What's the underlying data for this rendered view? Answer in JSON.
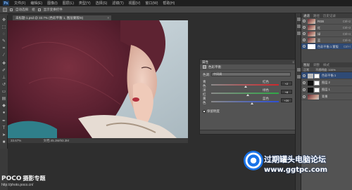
{
  "app": {
    "logo": "Ps"
  },
  "menu": [
    "文件(F)",
    "编辑(E)",
    "图像(I)",
    "图层(L)",
    "类型(Y)",
    "选择(S)",
    "滤镜(T)",
    "视图(V)",
    "窗口(W)",
    "帮助(H)"
  ],
  "options": {
    "label": "自动选择:",
    "mode": "组",
    "transform": "显示变换控件"
  },
  "document": {
    "tab": "未标题-1.psd @ 33.7% (色彩平衡 1, 图层蒙版/8)",
    "close": "×",
    "zoom": "33.67%",
    "info": "文档:45.3M/93.3M"
  },
  "color_balance": {
    "panel_title": "属性",
    "subtitle": "色彩平衡",
    "tone_label": "色调:",
    "tone_value": "中间调",
    "sliders": [
      {
        "left": "青色",
        "right": "红色",
        "value": "+2",
        "level": 0.51,
        "color": "#d0262b"
      },
      {
        "left": "洋红",
        "right": "绿色",
        "value": "+8",
        "level": 0.54,
        "color": "#2ea845"
      },
      {
        "left": "黄色",
        "right": "蓝色",
        "value": "+20",
        "level": 0.6,
        "color": "#2d4fd6"
      }
    ],
    "preserve": "保留明度"
  },
  "channels": {
    "tabs": [
      "通道",
      "路径",
      "历史记录"
    ],
    "items": [
      {
        "name": "RGB",
        "shortcut": "Ctrl+2"
      },
      {
        "name": "红",
        "shortcut": "Ctrl+3"
      },
      {
        "name": "绿",
        "shortcut": "Ctrl+4"
      },
      {
        "name": "蓝",
        "shortcut": "Ctrl+5"
      },
      {
        "name": "色彩平衡 1 蒙版",
        "shortcut": "Ctrl+\\"
      }
    ]
  },
  "layers": {
    "tabs": [
      "图层",
      "调整",
      "样式"
    ],
    "blend": "正常",
    "opacity": "不透明度: 100%",
    "items": [
      {
        "name": "色彩平衡 1"
      },
      {
        "name": "图层 2"
      },
      {
        "name": "图层 1"
      },
      {
        "name": "背景"
      }
    ]
  },
  "watermarks": {
    "poco_brand": "POCO",
    "poco_sub": "摄影专题",
    "poco_url": "http://photo.poco.cn/",
    "site_name": "过期罐头电脑论坛",
    "site_url": "www.ggtpc.com"
  }
}
